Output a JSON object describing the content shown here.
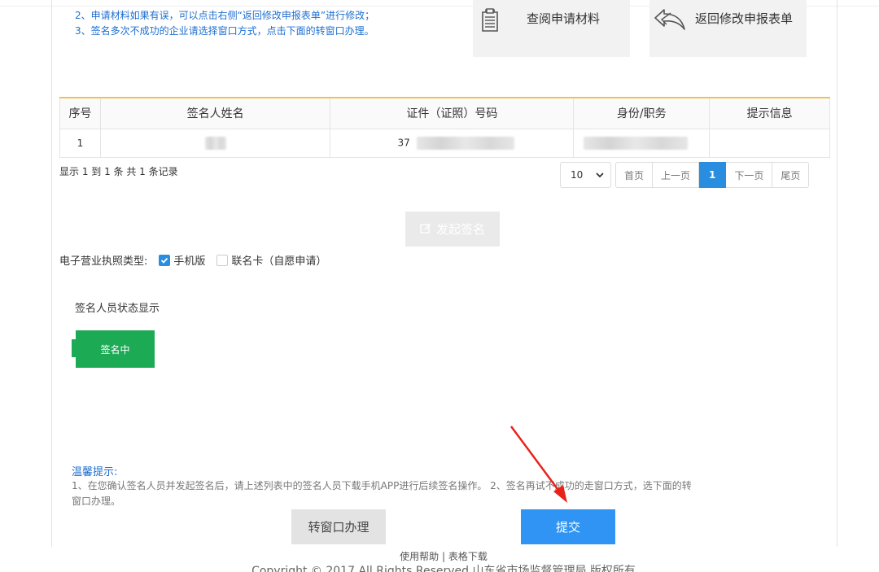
{
  "notes": {
    "line2": "2、申请材料如果有误，可以点击右侧“返回修改申报表单”进行修改；",
    "line3": "3、签名多次不成功的企业请选择窗口方式，点击下面的转窗口办理。"
  },
  "actions": {
    "view_label": "查阅申请材料",
    "back_label": "返回修改申报表单"
  },
  "table": {
    "headers": [
      "序号",
      "签名人姓名",
      "证件（证照）号码",
      "身份/职务",
      "提示信息"
    ],
    "rows": [
      {
        "index": "1",
        "name": "",
        "id_prefix": "37",
        "role": "",
        "hint": ""
      }
    ]
  },
  "pagination": {
    "record_info": "显示 1 到 1 条 共 1 条记录",
    "page_size": "10",
    "first": "首页",
    "prev": "上一页",
    "current": "1",
    "next": "下一页",
    "last": "尾页"
  },
  "sign": {
    "button_label": "发起签名"
  },
  "license": {
    "label": "电子营业执照类型:",
    "option_mobile": "手机版",
    "option_card": "联名卡（自愿申请）",
    "mobile_checked": true,
    "card_checked": false
  },
  "status": {
    "title": "签名人员状态显示",
    "badge": "签名中",
    "badge_color": "#1daa55"
  },
  "tips": {
    "title": "温馨提示:",
    "text": "1、在您确认签名人员并发起签名后，请上述列表中的签名人员下载手机APP进行后续签名操作。 2、签名再试不成功的走窗口方式，选下面的转窗口办理。"
  },
  "buttons": {
    "window": "转窗口办理",
    "submit": "提交",
    "submit_color": "#2f94f3"
  },
  "footer": {
    "links": "使用帮助 | 表格下载",
    "copyright": "Copyright © 2017 All Rights Reserved  山东省市场监督管理局 版权所有"
  }
}
